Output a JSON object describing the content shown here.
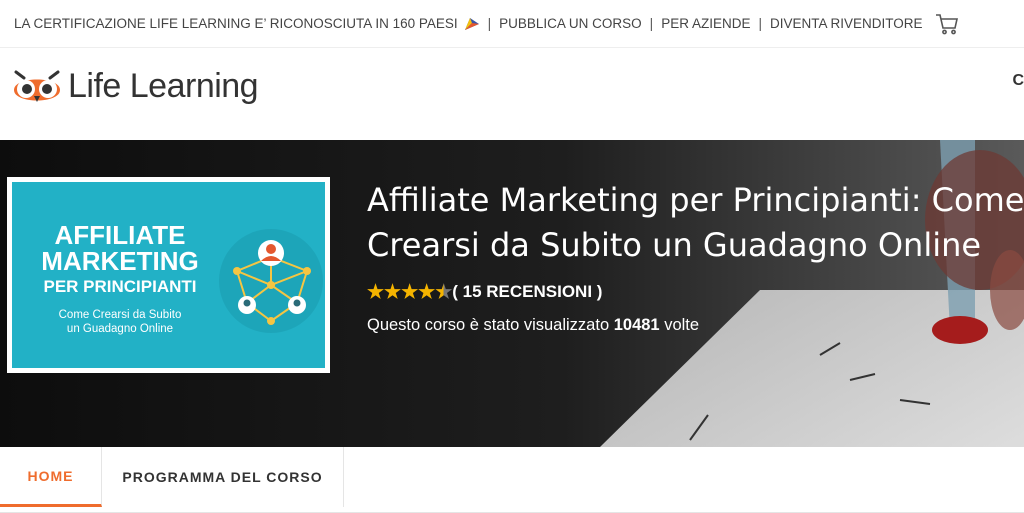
{
  "topbar": {
    "certification_text": "LA CERTIFICAZIONE LIFE LEARNING E’ RICONOSCIUTA IN 160 PAESI",
    "publish_link": "PUBBLICA UN CORSO",
    "business_link": "PER AZIENDE",
    "reseller_link": "DIVENTA RIVENDITORE",
    "separator": "|",
    "icons": {
      "flag": "flag-icon",
      "cart": "cart-icon"
    }
  },
  "header": {
    "brand": "Life Learning",
    "edge_text": "C",
    "logo_icon": "owl-logo-icon"
  },
  "hero": {
    "thumbnail": {
      "line1": "AFFILIATE",
      "line2": "MARKETING",
      "line3": "PER PRINCIPIANTI",
      "subtitle1": "Come Crearsi da Subito",
      "subtitle2": "un Guadagno Online",
      "icon": "network-people-icon"
    },
    "title_line1": "Affiliate Marketing per Principianti: Come",
    "title_line2": "Crearsi da Subito un Guadagno Online",
    "rating_value": 4.5,
    "reviews_text": "( 15 RECENSIONI )",
    "views_prefix": "Questo corso è stato visualizzato",
    "views_count": "10481",
    "views_suffix": "volte"
  },
  "tabs": [
    {
      "label": "HOME",
      "active": true
    },
    {
      "label": "PROGRAMMA DEL CORSO",
      "active": false
    }
  ],
  "colors": {
    "accent": "#ef6c2d",
    "star": "#f5b400",
    "thumbnail_bg": "#22b1c6",
    "hero_bg": "#151515"
  }
}
